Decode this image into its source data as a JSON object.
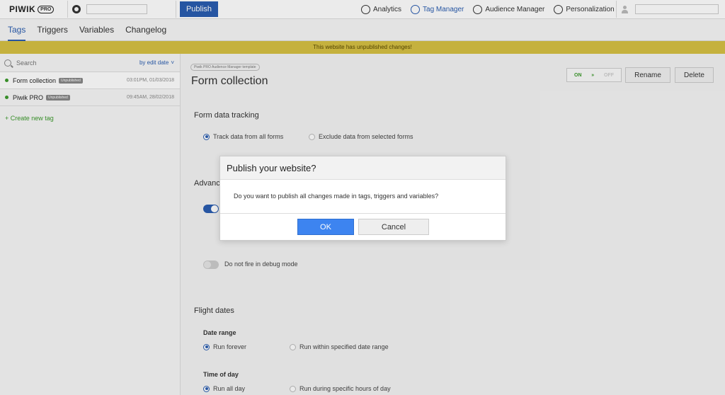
{
  "header": {
    "logo_text": "PIWIK",
    "logo_badge": "PRO",
    "publish_label": "Publish",
    "modules": [
      {
        "label": "Analytics",
        "icon": "analytics-icon"
      },
      {
        "label": "Tag Manager",
        "icon": "tag-manager-icon",
        "active": true
      },
      {
        "label": "Audience Manager",
        "icon": "audience-manager-icon"
      },
      {
        "label": "Personalization",
        "icon": "personalization-icon"
      }
    ]
  },
  "tabs": [
    {
      "label": "Tags",
      "active": true
    },
    {
      "label": "Triggers"
    },
    {
      "label": "Variables"
    },
    {
      "label": "Changelog"
    }
  ],
  "warning_text": "This website has unpublished changes!",
  "sidebar": {
    "search_placeholder": "Search",
    "sort_label": "by edit date",
    "sort_arrow": "˅",
    "tags": [
      {
        "name": "Form collection",
        "badge": "Unpublished",
        "date": "03:01PM, 01/03/2018"
      },
      {
        "name": "Piwik PRO",
        "badge": "Unpublished",
        "date": "09:45AM, 28/02/2018"
      }
    ],
    "create_label": "+ Create new tag"
  },
  "main": {
    "template_chip": "Piwik PRO Audience Manager template",
    "title": "Form collection",
    "on_label": "ON",
    "arrow_glyph": "»",
    "off_label": "OFF",
    "rename_label": "Rename",
    "delete_label": "Delete",
    "form_tracking_title": "Form data tracking",
    "track_all_label": "Track data from all forms",
    "exclude_label": "Exclude data from selected forms",
    "advanced_title_partial": "Advanc",
    "debug_label": "Do not fire in debug mode",
    "flight_dates_title": "Flight dates",
    "date_range_title": "Date range",
    "run_forever_label": "Run forever",
    "run_within_label": "Run within specified date range",
    "time_of_day_title": "Time of day",
    "run_all_day_label": "Run all day",
    "run_hours_label": "Run during specific hours of day"
  },
  "modal": {
    "title": "Publish your website?",
    "body": "Do you want to publish all changes made in tags, triggers and variables?",
    "ok_label": "OK",
    "cancel_label": "Cancel"
  },
  "colors": {
    "accent": "#2a5db0",
    "ok_button": "#3d84f0",
    "warning_bar": "#d6c044",
    "status_green": "#3c9a2c"
  }
}
